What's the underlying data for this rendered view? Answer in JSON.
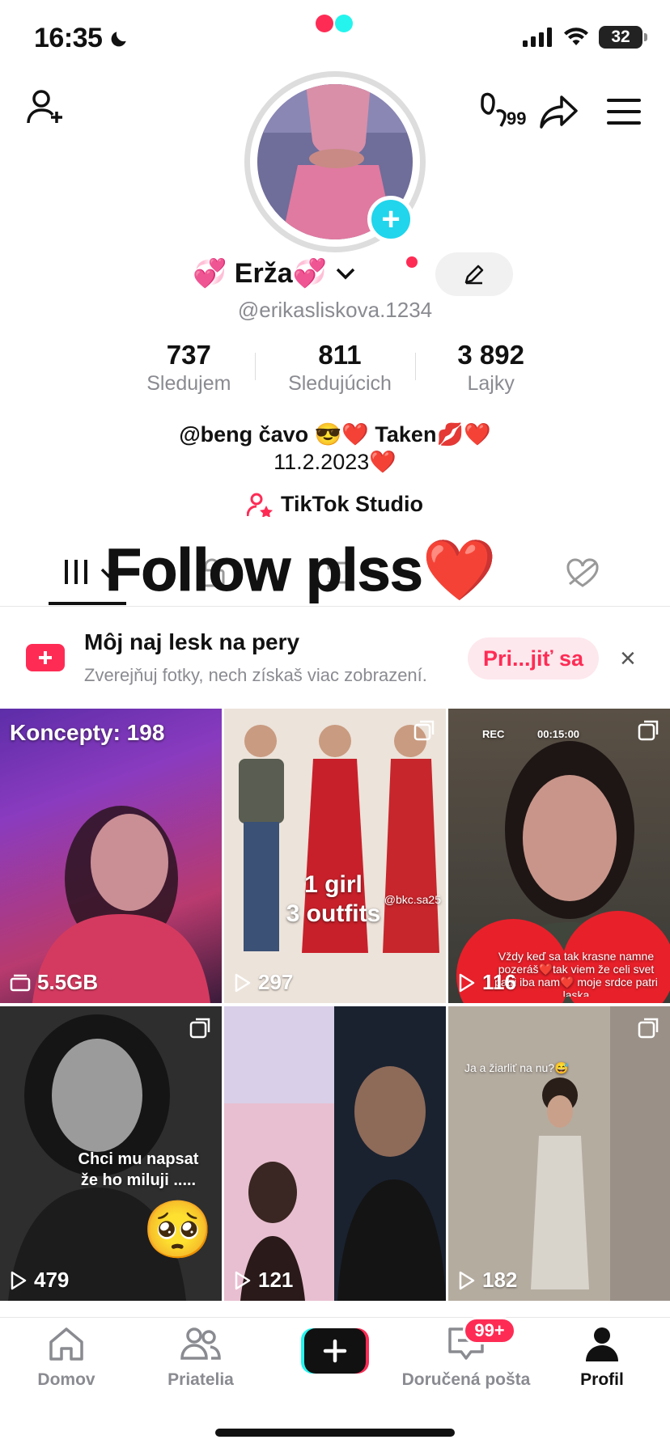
{
  "status_bar": {
    "time": "16:35",
    "battery": "32"
  },
  "profile": {
    "name": "💞 Erža💞",
    "handle": "@erikasliskova.1234",
    "stats": [
      {
        "value": "737",
        "label": "Sledujem"
      },
      {
        "value": "811",
        "label": "Sledujúcich"
      },
      {
        "value": "3 892",
        "label": "Lajky"
      }
    ],
    "bio_line1": "@beng čavo 😎❤️ Taken💋❤️",
    "bio_line2": "11.2.2023❤️",
    "studio_link": "TikTok Studio",
    "overlay_caption": "Follow plss❤️"
  },
  "header": {
    "notification_count": "99"
  },
  "banner": {
    "title": "Môj naj lesk na pery",
    "subtitle": "Zverejňuj fotky, nech získaš viac zobrazení.",
    "button": "Pri...jiť sa",
    "close": "×"
  },
  "videos": [
    {
      "views": "5.5GB",
      "caption": "Koncepty: 198"
    },
    {
      "views": "297",
      "caption_line1": "1 girl",
      "caption_line2": "3 outfits",
      "rec_text": "",
      "watermark": "@bkc.sa25"
    },
    {
      "views": "116",
      "rec": "REC",
      "rec_time": "00:15:00",
      "caption": "Vždy keď sa tak krasne namne pozeráš❤️tak viem že celi svet patri iba nam❤️ moje srdce patri laska"
    },
    {
      "views": "479",
      "caption_line1": "Chci mu napsat",
      "caption_line2": "že ho  miluji .....",
      "emoji": "🥺"
    },
    {
      "views": "121"
    },
    {
      "views": "182",
      "caption": "Ja a žiarliť na nu?😅"
    }
  ],
  "nav": [
    {
      "label": "Domov"
    },
    {
      "label": "Priatelia"
    },
    {
      "label": ""
    },
    {
      "label": "Doručená pošta",
      "badge": "99+"
    },
    {
      "label": "Profil"
    }
  ],
  "colors": {
    "accent": "#fe2c55",
    "cyan": "#20d5ec",
    "muted": "#8a8b91"
  }
}
